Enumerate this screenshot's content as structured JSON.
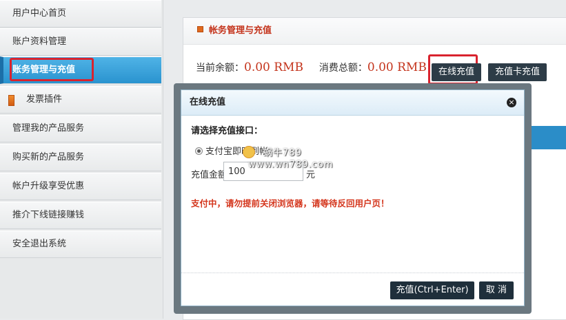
{
  "sidebar": {
    "items": [
      {
        "label": "用户中心首页"
      },
      {
        "label": "账户资料管理"
      },
      {
        "label": "账务管理与充值"
      },
      {
        "label": "发票插件"
      },
      {
        "label": "管理我的产品服务"
      },
      {
        "label": "购买新的产品服务"
      },
      {
        "label": "帐户升级享受优惠"
      },
      {
        "label": "推介下线链接赚钱"
      },
      {
        "label": "安全退出系统"
      }
    ]
  },
  "panel": {
    "title": "帐务管理与充值",
    "balance_label": "当前余额：",
    "balance_value": "0.00 RMB",
    "spent_label": "消费总额：",
    "spent_value": "0.00 RMB",
    "online_button": "在线充值",
    "card_button": "充值卡充值"
  },
  "dialog": {
    "title": "在线充值",
    "close_icon": "×",
    "gateway_label": "请选择充值接口：",
    "gateway_option": "支付宝即时到帐",
    "amount_label": "充值金额：",
    "amount_value": "100",
    "amount_unit": "元",
    "warning": "支付中，请勿提前关闭浏览器，请等待反回用户页！",
    "submit_button": "充值(Ctrl+Enter)",
    "cancel_button": "取 消"
  },
  "watermark": {
    "line1": "蜗牛789",
    "line2": "www.wn789.com"
  },
  "colors": {
    "accent_blue": "#2b8dc8",
    "highlight_red": "#d9232e",
    "money_red": "#c4341c",
    "button_dark": "#2d3c47"
  }
}
